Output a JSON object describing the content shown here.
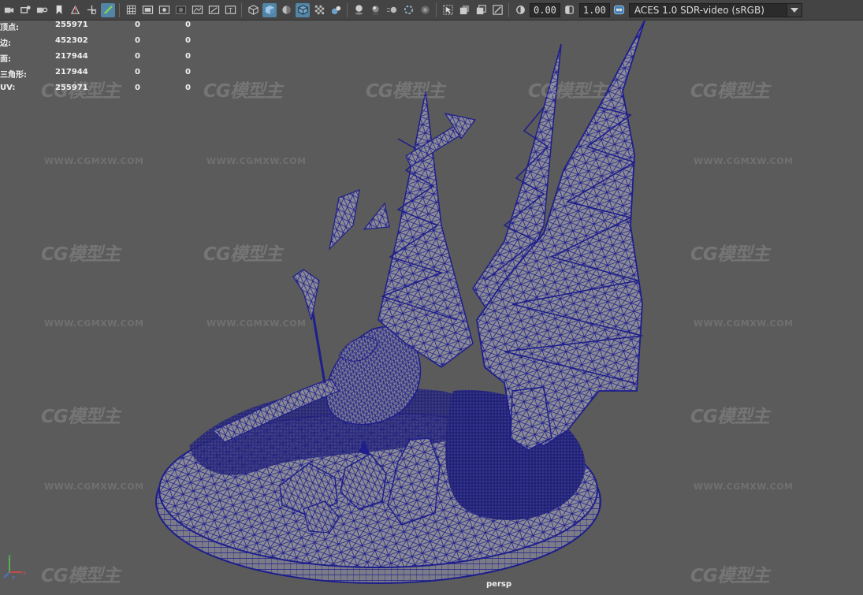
{
  "toolbar": {
    "exposure_value": "0.00",
    "gamma_value": "1.00",
    "color_management": {
      "selected": "ACES 1.0 SDR-video (sRGB)"
    },
    "icons": [
      "select-camera-icon",
      "camera-attributes-icon",
      "bookmark-icon",
      "bookmark-flag-icon",
      "image-plane-icon",
      "pan-zoom-icon",
      "grease-pencil-icon",
      "grid-icon",
      "film-gate-icon",
      "resolution-gate-icon",
      "gate-mask-icon",
      "field-chart-icon",
      "safe-action-icon",
      "safe-title-icon",
      "wireframe-icon",
      "smooth-shade-icon",
      "default-material-icon",
      "wireframe-on-shaded-icon",
      "xray-icon",
      "use-all-lights-icon",
      "shadows-icon",
      "screen-space-ao-icon",
      "motion-blur-icon",
      "anti-aliasing-icon",
      "depth-of-field-icon",
      "isolate-select-icon",
      "xray-joints-icon",
      "xray-active-icon",
      "backface-culling-icon",
      "exposure-icon",
      "gamma-icon",
      "view-transform-icon"
    ]
  },
  "hud": {
    "rows": [
      {
        "label": "顶点:",
        "v1": "255971",
        "v2": "0",
        "v3": "0"
      },
      {
        "label": "边:",
        "v1": "452302",
        "v2": "0",
        "v3": "0"
      },
      {
        "label": "面:",
        "v1": "217944",
        "v2": "0",
        "v3": "0"
      },
      {
        "label": "三角形:",
        "v1": "217944",
        "v2": "0",
        "v3": "0"
      },
      {
        "label": "UV:",
        "v1": "255971",
        "v2": "0",
        "v3": "0"
      }
    ]
  },
  "viewport": {
    "camera_name": "persp",
    "axis": {
      "x": "x",
      "y": "y",
      "z": "z"
    }
  },
  "watermark": {
    "logo": "CG模型主",
    "url": "WWW.CGMXW.COM"
  },
  "colors": {
    "toolbar_bg": "#444444",
    "viewport_bg": "#5b5b5b",
    "wireframe": "#1e1e8c",
    "mesh_fill": "#8a8a94",
    "active_button": "#5285a6"
  }
}
